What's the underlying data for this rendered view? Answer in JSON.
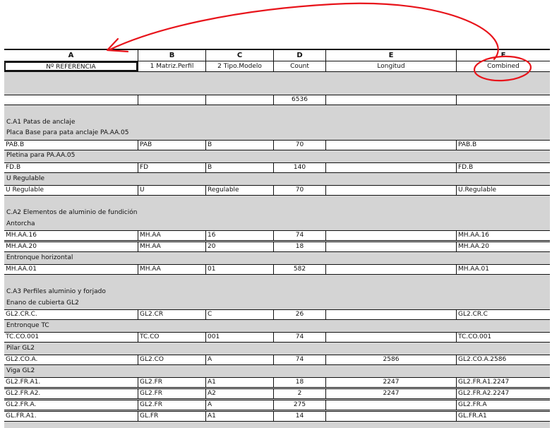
{
  "columns": [
    "A",
    "B",
    "C",
    "D",
    "E",
    "F"
  ],
  "headers": [
    "Nº REFERENCIA",
    "1 Matriz.Perfil",
    "2 Tipo.Modelo",
    "Count",
    "Longitud",
    "Combined"
  ],
  "total": {
    "count": "6536"
  },
  "groups": [
    {
      "title": "C.A1 Patas de anclaje"
    },
    {
      "title": "C.A2 Elementos de aluminio de fundición"
    },
    {
      "title": "C.A3 Perfiles aluminio y forjado"
    }
  ],
  "subgroups": [
    "Placa Base para pata anclaje PA.AA.05",
    "Pletina para PA.AA.05",
    "U Regulable",
    "Antorcha",
    "Entronque horizontal",
    "Enano de cubierta GL2",
    "Entronque TC",
    "Pilar GL2",
    "Viga GL2"
  ],
  "rows": [
    {
      "a": "PAB.B",
      "b": "PAB",
      "c": "B",
      "d": "70",
      "e": "",
      "f": "PAB.B"
    },
    {
      "a": "FD.B",
      "b": "FD",
      "c": "B",
      "d": "140",
      "e": "",
      "f": "FD.B"
    },
    {
      "a": "U Regulable",
      "b": "U",
      "c": "Regulable",
      "d": "70",
      "e": "",
      "f": "U.Regulable"
    },
    {
      "a": "MH.AA.16",
      "b": "MH.AA",
      "c": "16",
      "d": "74",
      "e": "",
      "f": "MH.AA.16"
    },
    {
      "a": "MH.AA.20",
      "b": "MH.AA",
      "c": "20",
      "d": "18",
      "e": "",
      "f": "MH.AA.20"
    },
    {
      "a": "MH.AA.01",
      "b": "MH.AA",
      "c": "01",
      "d": "582",
      "e": "",
      "f": "MH.AA.01"
    },
    {
      "a": "GL2.CR.C.",
      "b": "GL2.CR",
      "c": "C",
      "d": "26",
      "e": "",
      "f": "GL2.CR.C"
    },
    {
      "a": "TC.CO.001",
      "b": "TC.CO",
      "c": "001",
      "d": "74",
      "e": "",
      "f": "TC.CO.001"
    },
    {
      "a": "GL2.CO.A.",
      "b": "GL2.CO",
      "c": "A",
      "d": "74",
      "e": "2586",
      "f": "GL2.CO.A.2586"
    },
    {
      "a": "GL2.FR.A1.",
      "b": "GL2.FR",
      "c": "A1",
      "d": "18",
      "e": "2247",
      "f": "GL2.FR.A1.2247"
    },
    {
      "a": "GL2.FR.A2.",
      "b": "GL2.FR",
      "c": "A2",
      "d": "2",
      "e": "2247",
      "f": "GL2.FR.A2.2247"
    },
    {
      "a": "GL2.FR.A.",
      "b": "GL2.FR",
      "c": "A",
      "d": "275",
      "e": "",
      "f": "GL2.FR.A"
    },
    {
      "a": "GL.FR.A1.",
      "b": "GL.FR",
      "c": "A1",
      "d": "14",
      "e": "",
      "f": "GL.FR.A1"
    }
  ],
  "annotation_color": "#e8141b"
}
